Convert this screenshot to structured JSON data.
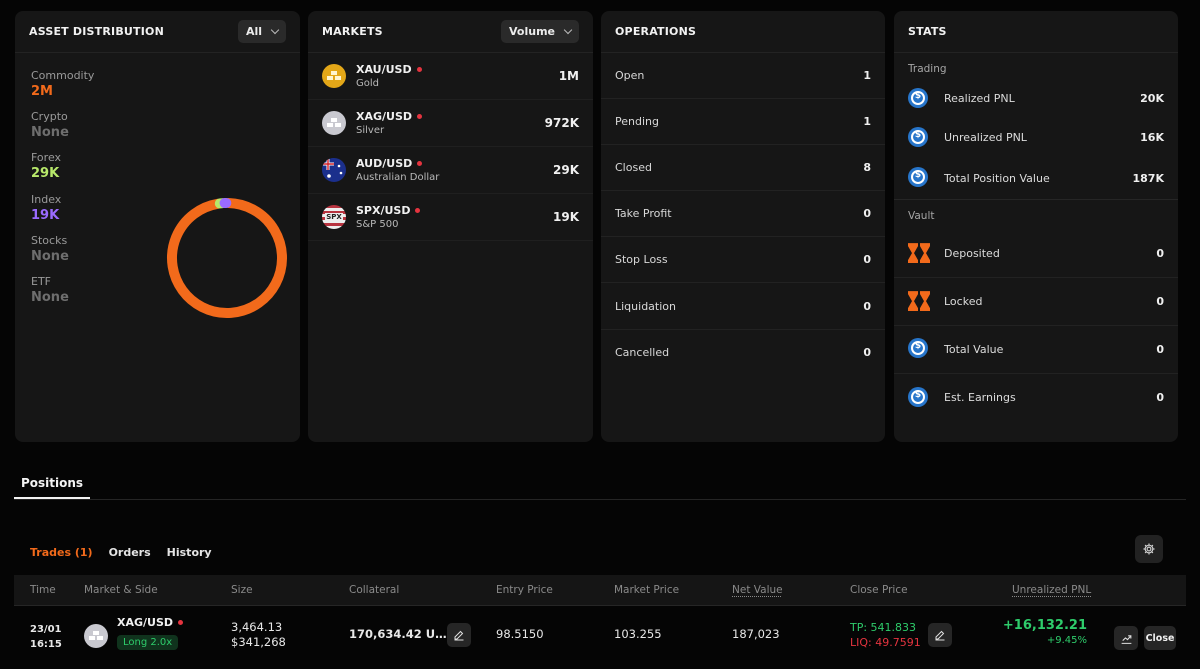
{
  "asset_distribution": {
    "title": "ASSET DISTRIBUTION",
    "filter": "All",
    "items": [
      {
        "label": "Commodity",
        "value": "2M",
        "color": "#f26a1b"
      },
      {
        "label": "Crypto",
        "value": "None",
        "color": "#6e6e6e"
      },
      {
        "label": "Forex",
        "value": "29K",
        "color": "#b7e86a"
      },
      {
        "label": "Index",
        "value": "19K",
        "color": "#9a6bff"
      },
      {
        "label": "Stocks",
        "value": "None",
        "color": "#6e6e6e"
      },
      {
        "label": "ETF",
        "value": "None",
        "color": "#6e6e6e"
      }
    ],
    "donut_shares": {
      "commodity": 0.975,
      "forex": 0.014,
      "index": 0.011
    }
  },
  "markets": {
    "title": "MARKETS",
    "sort": "Volume",
    "items": [
      {
        "symbol": "XAU/USD",
        "name": "Gold",
        "volume": "1M",
        "icon": "gold-bars-icon"
      },
      {
        "symbol": "XAG/USD",
        "name": "Silver",
        "volume": "972K",
        "icon": "silver-bars-icon"
      },
      {
        "symbol": "AUD/USD",
        "name": "Australian Dollar",
        "volume": "29K",
        "icon": "australia-flag-icon"
      },
      {
        "symbol": "SPX/USD",
        "name": "S&P 500",
        "volume": "19K",
        "icon": "spx-icon",
        "icon_text": "SPX"
      }
    ]
  },
  "operations": {
    "title": "OPERATIONS",
    "items": [
      {
        "label": "Open",
        "value": "1"
      },
      {
        "label": "Pending",
        "value": "1"
      },
      {
        "label": "Closed",
        "value": "8"
      },
      {
        "label": "Take Profit",
        "value": "0"
      },
      {
        "label": "Stop Loss",
        "value": "0"
      },
      {
        "label": "Liquidation",
        "value": "0"
      },
      {
        "label": "Cancelled",
        "value": "0"
      }
    ]
  },
  "stats": {
    "title": "STATS",
    "trading_label": "Trading",
    "trading": [
      {
        "label": "Realized PNL",
        "value": "20K"
      },
      {
        "label": "Unrealized PNL",
        "value": "16K"
      },
      {
        "label": "Total Position Value",
        "value": "187K"
      }
    ],
    "vault_label": "Vault",
    "vault": [
      {
        "label": "Deposited",
        "value": "0",
        "icon": "vault-icon"
      },
      {
        "label": "Locked",
        "value": "0",
        "icon": "vault-icon"
      },
      {
        "label": "Total Value",
        "value": "0",
        "icon": "usdc-icon"
      },
      {
        "label": "Est. Earnings",
        "value": "0",
        "icon": "usdc-icon"
      }
    ]
  },
  "positions": {
    "tab": "Positions",
    "subtabs": {
      "trades": "Trades (1)",
      "orders": "Orders",
      "history": "History"
    },
    "columns": {
      "time": "Time",
      "market": "Market & Side",
      "size": "Size",
      "collateral": "Collateral",
      "entry": "Entry Price",
      "market_price": "Market Price",
      "net_value": "Net Value",
      "close_price": "Close Price",
      "upnl": "Unrealized PNL"
    },
    "rows": [
      {
        "date": "23/01",
        "time": "16:15",
        "symbol": "XAG/USD",
        "side": "Long 2.0x",
        "size": "3,464.13",
        "size_usd": "$341,268",
        "collateral": "170,634.42 U…",
        "entry": "98.5150",
        "market_price": "103.255",
        "net_value": "187,023",
        "tp": "TP: 541.833",
        "liq": "LIQ: 49.7591",
        "pnl": "+16,132.21",
        "pnl_pct": "+9.45%",
        "close": "Close"
      }
    ]
  }
}
